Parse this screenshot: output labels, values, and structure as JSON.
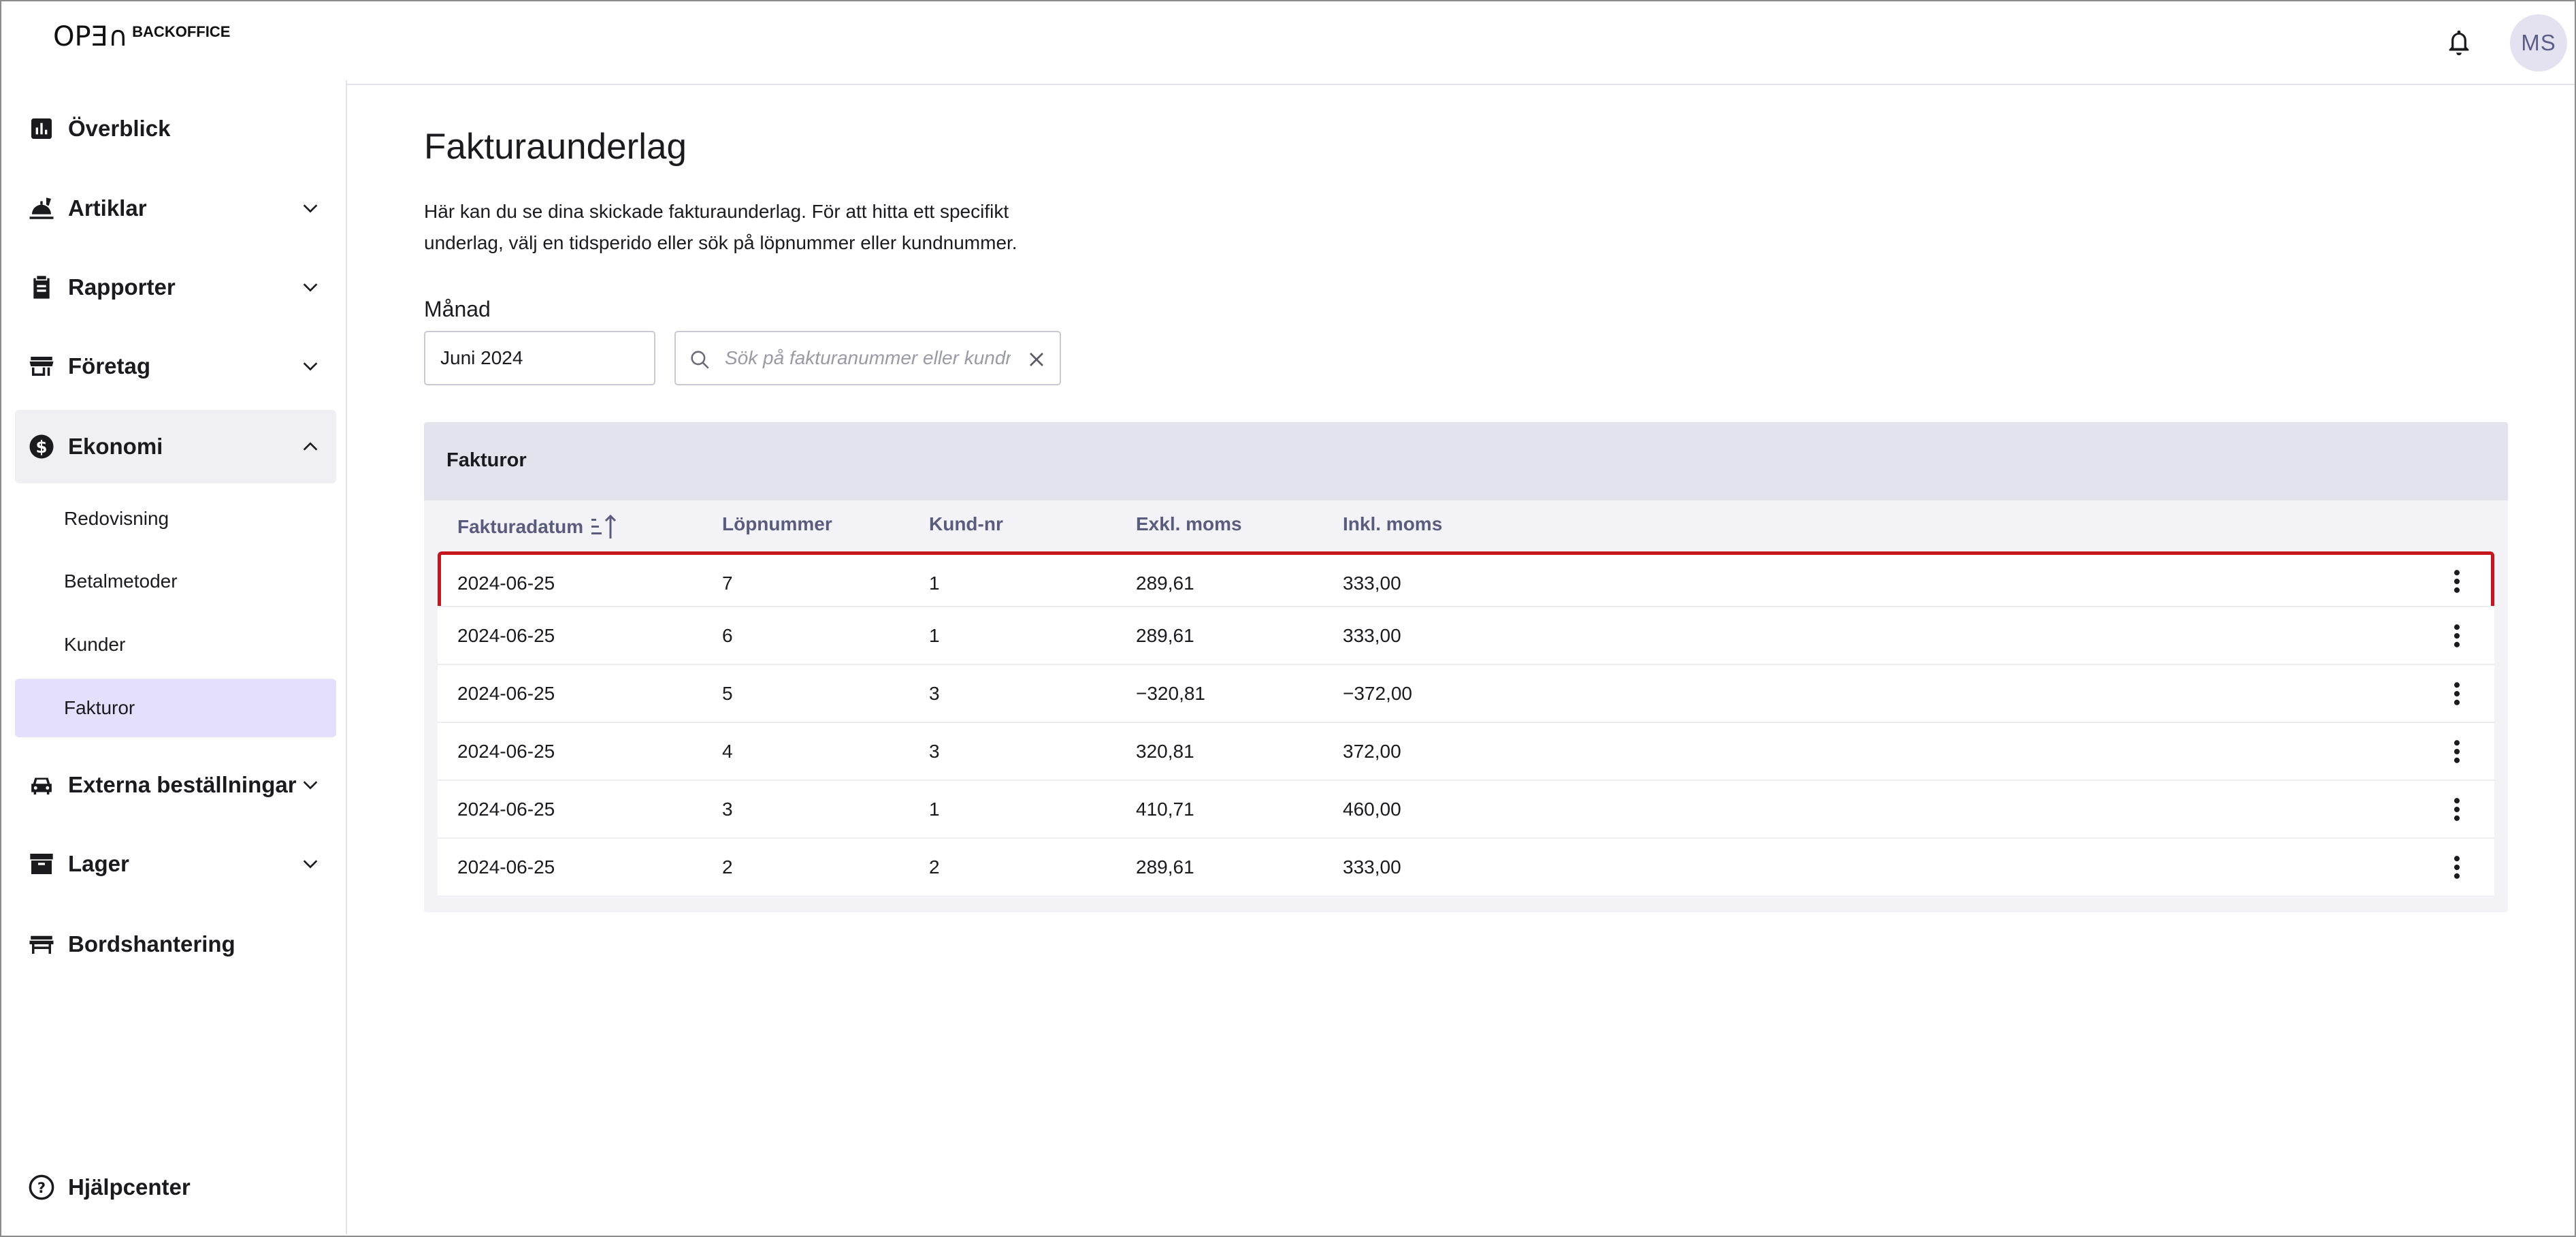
{
  "header": {
    "logo_mark": "OPƎ∩",
    "logo_text": "BACKOFFICE",
    "avatar_initials": "MS",
    "bell_icon": "bell-icon"
  },
  "sidebar": {
    "items": [
      {
        "label": "Överblick",
        "icon": "bar-chart-icon",
        "expandable": false
      },
      {
        "label": "Artiklar",
        "icon": "food-icon",
        "expandable": true
      },
      {
        "label": "Rapporter",
        "icon": "clipboard-icon",
        "expandable": true
      },
      {
        "label": "Företag",
        "icon": "store-icon",
        "expandable": true
      },
      {
        "label": "Ekonomi",
        "icon": "dollar-icon",
        "expandable": true,
        "open": true
      },
      {
        "label": "Externa beställningar",
        "icon": "car-icon",
        "expandable": true
      },
      {
        "label": "Lager",
        "icon": "archive-icon",
        "expandable": true
      },
      {
        "label": "Bordshantering",
        "icon": "table-icon",
        "expandable": false
      }
    ],
    "ekonomi_sub": [
      "Redovisning",
      "Betalmetoder",
      "Kunder",
      "Fakturor"
    ],
    "active_sub": "Fakturor",
    "help": "Hjälpcenter"
  },
  "main": {
    "title": "Fakturaunderlag",
    "description": "Här kan du se dina skickade fakturaunderlag. För att hitta ett specifikt underlag, välj en tidsperido eller sök på löpnummer eller kundnummer.",
    "month_label": "Månad",
    "month_value": "Juni 2024",
    "search_placeholder": "Sök på fakturanummer eller kundnummer"
  },
  "table": {
    "title": "Fakturor",
    "columns": [
      "Fakturadatum",
      "Löpnummer",
      "Kund-nr",
      "Exkl. moms",
      "Inkl. moms"
    ],
    "rows": [
      {
        "date": "2024-06-25",
        "lop": "7",
        "kund": "1",
        "exkl": "289,61",
        "inkl": "333,00",
        "selected": true
      },
      {
        "date": "2024-06-25",
        "lop": "6",
        "kund": "1",
        "exkl": "289,61",
        "inkl": "333,00"
      },
      {
        "date": "2024-06-25",
        "lop": "5",
        "kund": "3",
        "exkl": "−320,81",
        "inkl": "−372,00"
      },
      {
        "date": "2024-06-25",
        "lop": "4",
        "kund": "3",
        "exkl": "320,81",
        "inkl": "372,00"
      },
      {
        "date": "2024-06-25",
        "lop": "3",
        "kund": "1",
        "exkl": "410,71",
        "inkl": "460,00"
      },
      {
        "date": "2024-06-25",
        "lop": "2",
        "kund": "2",
        "exkl": "289,61",
        "inkl": "333,00"
      }
    ]
  },
  "colors": {
    "accent": "#5a5c7e",
    "selection_border": "#c4161c",
    "active_nav_bg": "#e3dffd",
    "open_nav_bg": "#efeff4",
    "card_header_bg": "#e2e3ed"
  }
}
